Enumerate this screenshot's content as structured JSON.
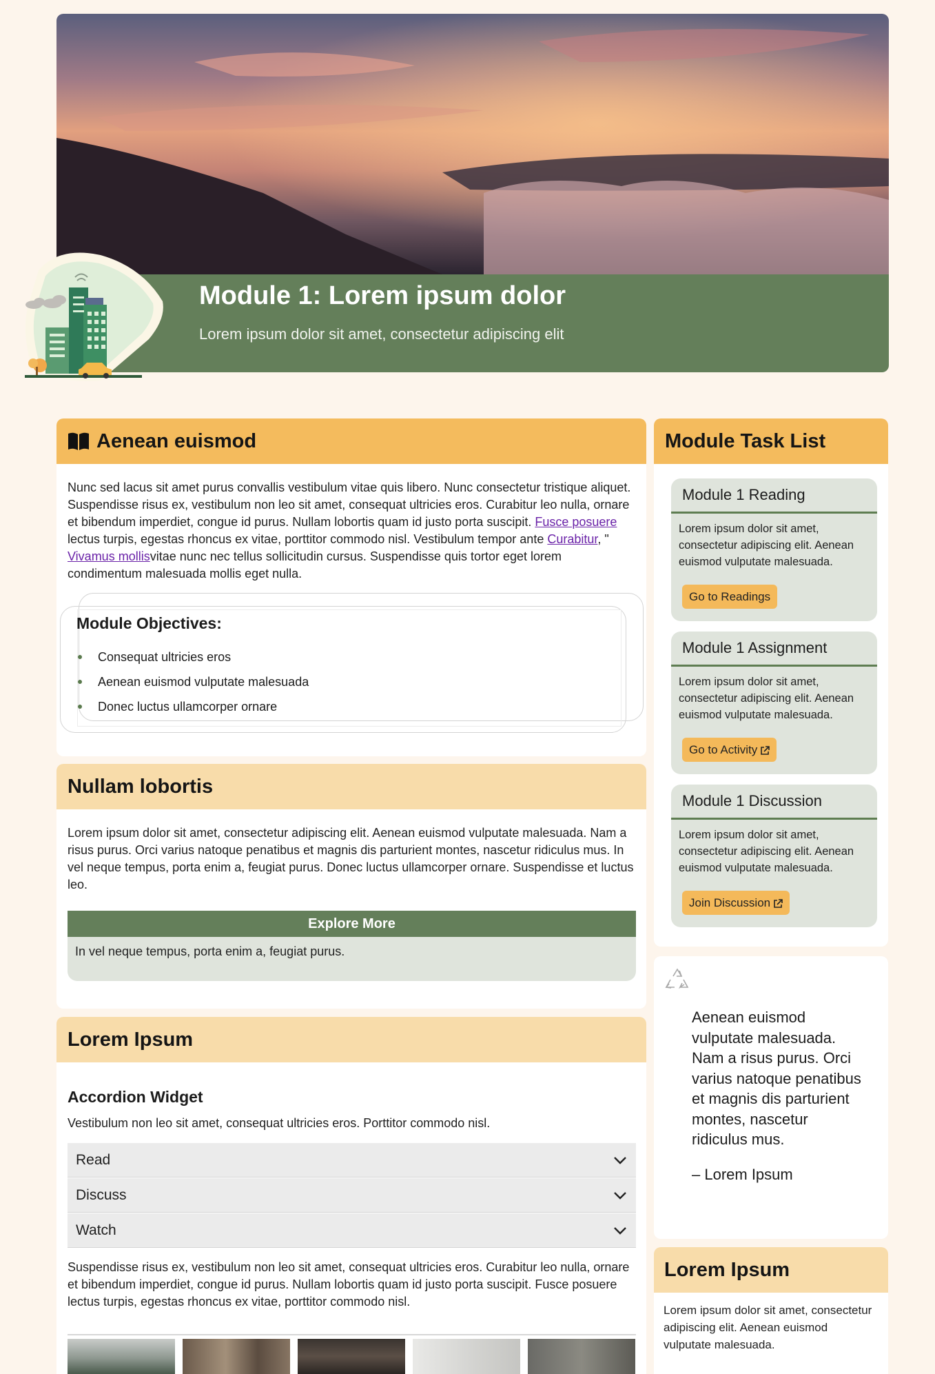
{
  "hero": {
    "title": "Module 1: Lorem ipsum dolor",
    "subtitle": "Lorem ipsum dolor sit amet, consectetur adipiscing elit"
  },
  "main_card": {
    "heading": "Aenean euismod",
    "p_before_link1": "Nunc sed lacus sit amet purus convallis vestibulum vitae quis libero. Nunc consectetur tristique aliquet. Suspendisse risus ex, vestibulum non leo sit amet, consequat ultricies eros. Curabitur leo nulla, ornare et bibendum imperdiet, congue id purus. Nullam lobortis quam id justo porta suscipit. ",
    "link1": "Fusce posuere",
    "p_between_1": " lectus turpis, egestas rhoncus ex vitae, porttitor commodo nisl. Vestibulum tempor ante ",
    "link2": "Curabitur",
    "p_between_2": ", \" ",
    "link3": "Vivamus mollis",
    "p_after": "vitae nunc nec tellus sollicitudin cursus. Suspendisse quis tortor eget lorem condimentum malesuada mollis eget nulla.",
    "objectives_title": "Module Objectives:",
    "objectives": [
      "Consequat ultricies eros",
      "Aenean euismod vulputate malesuada",
      "Donec luctus ullamcorper ornare"
    ]
  },
  "nullam_card": {
    "heading": "Nullam lobortis",
    "paragraph": "Lorem ipsum dolor sit amet, consectetur adipiscing elit. Aenean euismod vulputate malesuada. Nam a risus purus. Orci varius natoque penatibus et magnis dis parturient montes, nascetur ridiculus mus. In vel neque tempus, porta enim a, feugiat purus. Donec luctus ullamcorper ornare. Suspendisse et luctus leo.",
    "explore_header": "Explore More",
    "explore_text": "In vel neque tempus, porta enim a, feugiat purus."
  },
  "lorem_card": {
    "heading": "Lorem Ipsum",
    "accordion_title": "Accordion Widget",
    "accordion_intro": "Vestibulum non leo sit amet, consequat ultricies eros. Porttitor commodo nisl.",
    "accordion_items": [
      "Read",
      "Discuss",
      "Watch"
    ],
    "paragraph": "Suspendisse risus ex, vestibulum non leo sit amet, consequat ultricies eros. Curabitur leo nulla, ornare et bibendum imperdiet, congue id purus. Nullam lobortis quam id justo porta suscipit. Fusce posuere lectus turpis, egestas rhoncus ex vitae, porttitor commodo nisl."
  },
  "task_list": {
    "heading": "Module Task List",
    "items": [
      {
        "title": "Module 1 Reading",
        "text": "Lorem ipsum dolor sit amet, consectetur adipiscing elit. Aenean euismod vulputate malesuada.",
        "button": "Go to Readings",
        "external": false
      },
      {
        "title": "Module 1 Assignment",
        "text": "Lorem ipsum dolor sit amet, consectetur adipiscing elit. Aenean euismod vulputate malesuada.",
        "button": "Go to Activity",
        "external": true
      },
      {
        "title": "Module 1 Discussion",
        "text": "Lorem ipsum dolor sit amet, consectetur adipiscing elit. Aenean euismod vulputate malesuada.",
        "button": "Join Discussion",
        "external": true
      }
    ]
  },
  "quote_card": {
    "icon": "recycle-icon",
    "quote": "Aenean euismod vulputate malesuada. Nam a risus purus. Orci varius natoque penatibus et magnis dis parturient montes, nascetur ridiculus mus.",
    "attribution": "– Lorem Ipsum"
  },
  "side_lorem_card": {
    "heading": "Lorem Ipsum",
    "text": "Lorem ipsum dolor sit amet, consectetur adipiscing elit. Aenean euismod vulputate malesuada."
  },
  "colors": {
    "page_bg": "#fdf5ec",
    "green": "#647f5a",
    "orange": "#f4bb5d",
    "light_orange": "#f8dcaa",
    "task_bg": "#dfe4dc",
    "link": "#6a22a8"
  }
}
